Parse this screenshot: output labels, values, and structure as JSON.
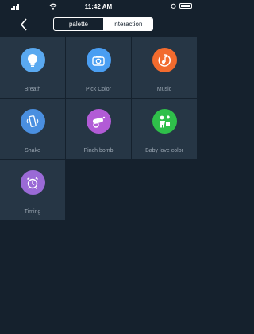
{
  "status_bar": {
    "time": "11:42 AM"
  },
  "nav": {
    "tabs": [
      {
        "label": "palette",
        "active": false
      },
      {
        "label": "interaction",
        "active": true
      }
    ]
  },
  "tiles": [
    {
      "label": "Breath",
      "icon": "lightbulb-icon",
      "color": "#5aa9f0"
    },
    {
      "label": "Pick Color",
      "icon": "camera-icon",
      "color": "#4a9ef2"
    },
    {
      "label": "Music",
      "icon": "music-icon",
      "color": "#f26b2e"
    },
    {
      "label": "Shake",
      "icon": "phone-shake-icon",
      "color": "#4a8fe0"
    },
    {
      "label": "Pinch bomb",
      "icon": "cannon-icon",
      "color": "#b25bd6"
    },
    {
      "label": "Baby love color",
      "icon": "baby-icon",
      "color": "#2fbf4a"
    },
    {
      "label": "Timing",
      "icon": "alarm-clock-icon",
      "color": "#9a6ad6"
    }
  ],
  "colors": {
    "background": "#15212d",
    "tile": "#263645",
    "label": "#9aa6b2"
  }
}
